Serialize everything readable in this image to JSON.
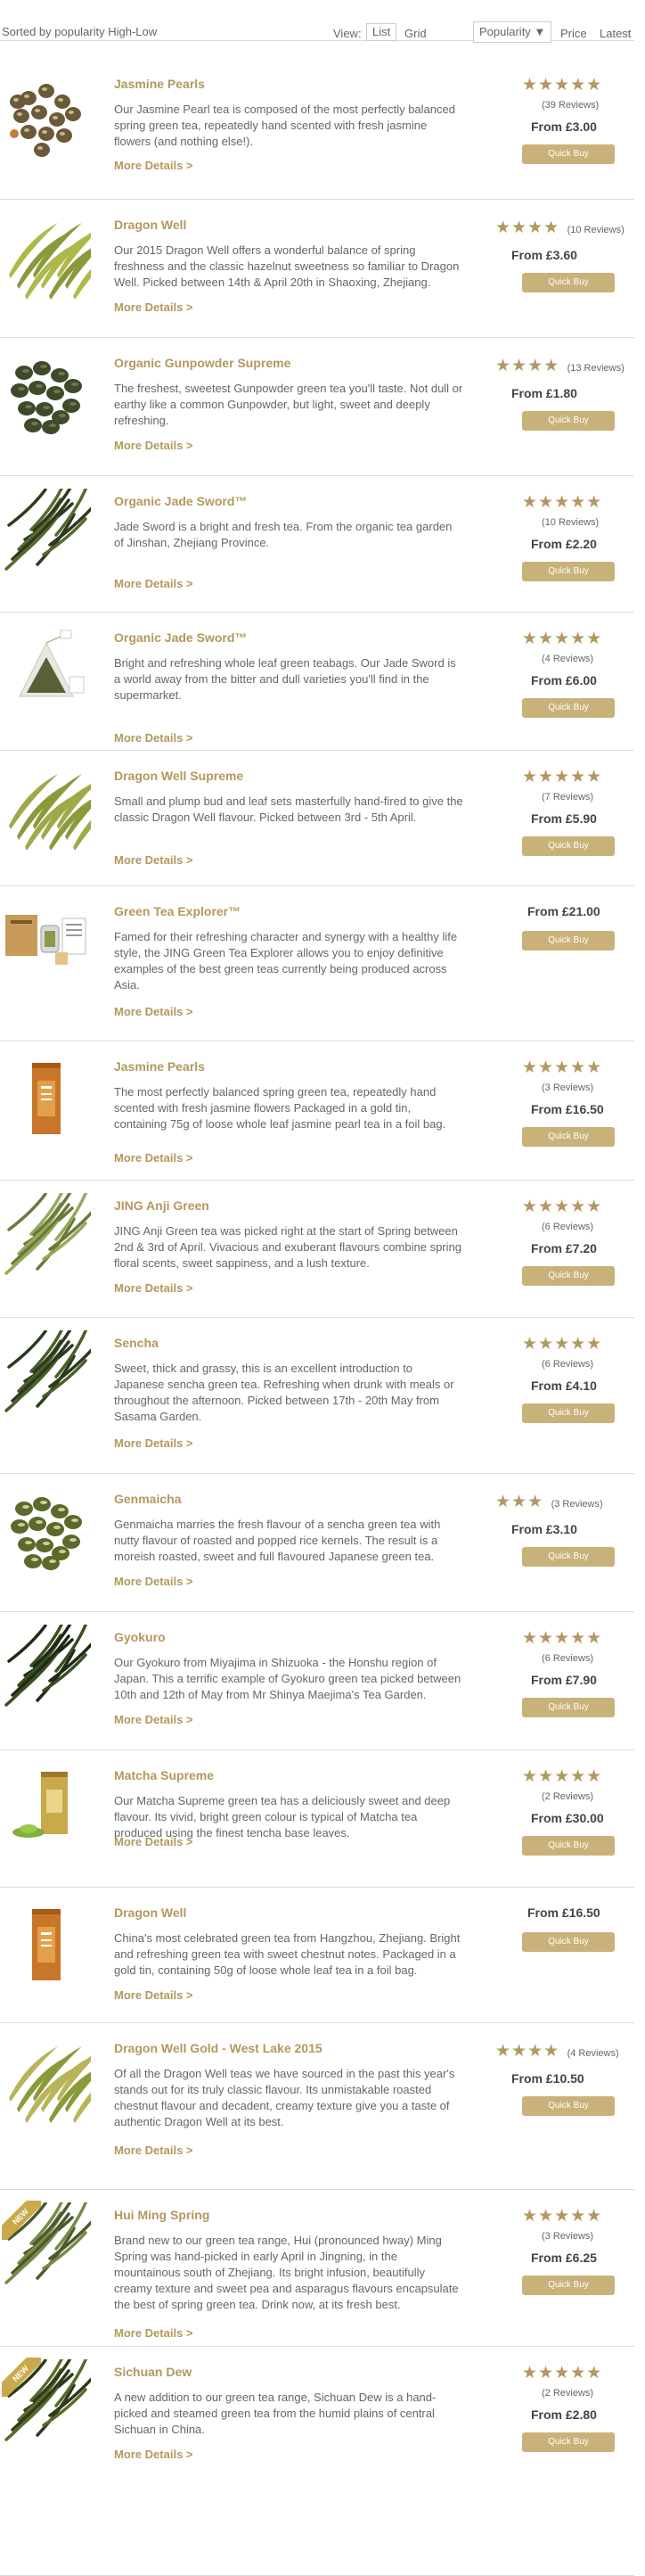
{
  "toolbar": {
    "sorted_by": "Sorted by popularity High-Low",
    "view_label": "View:",
    "view_list": "List",
    "view_grid": "Grid",
    "sort_popularity": "Popularity ▼",
    "sort_price": "Price",
    "sort_latest": "Latest"
  },
  "colors": {
    "accent": "#b3985d",
    "button": "#c9b27a",
    "separator": "#dcdcdc"
  },
  "labels": {
    "more_details": "More Details >",
    "quick_buy": "Quick Buy",
    "new_badge": "NEW"
  },
  "products": [
    {
      "name": "Jasmine Pearls",
      "desc": "Our Jasmine Pearl tea is composed of the most perfectly balanced spring green tea, repeatedly hand scented with fresh jasmine flowers (and nothing else!).",
      "rating": 5,
      "reviews": "(39 Reviews)",
      "price": "From £3.00",
      "image": "jasmine-pearls-image"
    },
    {
      "name": "Dragon Well",
      "desc": "Our 2015 Dragon Well offers a wonderful balance of spring freshness and the classic hazelnut sweetness so familiar to Dragon Well. Picked between 14th & April 20th in Shaoxing, Zhejiang.",
      "rating": 4,
      "reviews": "(10 Reviews)",
      "price": "From £3.60",
      "image": "dragon-well-image"
    },
    {
      "name": "Organic Gunpowder Supreme",
      "desc": "The freshest, sweetest Gunpowder green tea you'll taste. Not dull or earthy like a common Gunpowder, but light, sweet and deeply refreshing.",
      "rating": 4,
      "reviews": "(13 Reviews)",
      "price": "From £1.80",
      "image": "gunpowder-image"
    },
    {
      "name": "Organic Jade Sword™",
      "desc": "Jade Sword is a bright and fresh tea. From the organic tea garden of Jinshan, Zhejiang Province.",
      "rating": 5,
      "reviews": "(10 Reviews)",
      "price": "From £2.20",
      "image": "jade-sword-image"
    },
    {
      "name": "Organic Jade Sword™",
      "desc": "Bright and refreshing whole leaf green teabags. Our Jade Sword is a world away from the bitter and dull varieties you'll find in the supermarket.",
      "rating": 5,
      "reviews": "(4 Reviews)",
      "price": "From £6.00",
      "image": "teabag-image"
    },
    {
      "name": "Dragon Well Supreme",
      "desc": "Small and plump bud and leaf sets masterfully hand-fired to give the classic Dragon Well flavour. Picked between 3rd - 5th April.",
      "rating": 5,
      "reviews": "(7 Reviews)",
      "price": "From £5.90",
      "image": "dragon-well-supreme-image"
    },
    {
      "name": "Green Tea Explorer™",
      "desc": "Famed for their refreshing character and synergy with a healthy life style, the JING Green Tea Explorer allows you to enjoy definitive examples of the best green teas currently being produced across Asia.",
      "rating": 0,
      "reviews": "",
      "price": "From £21.00",
      "image": "explorer-kit-image"
    },
    {
      "name": "Jasmine Pearls",
      "desc": "The most perfectly balanced spring green tea, repeatedly hand scented with fresh jasmine flowers Packaged in a gold tin, containing 75g of loose whole leaf jasmine pearl tea in a foil bag.",
      "rating": 5,
      "reviews": "(3 Reviews)",
      "price": "From £16.50",
      "image": "jasmine-tin-image"
    },
    {
      "name": "JING Anji Green",
      "desc": "JING Anji Green tea was picked right at the start of Spring between 2nd & 3rd of April. Vivacious and exuberant flavours combine spring floral scents, sweet sappiness, and a lush texture.",
      "rating": 5,
      "reviews": "(6 Reviews)",
      "price": "From £7.20",
      "image": "anji-green-image"
    },
    {
      "name": "Sencha",
      "desc": "Sweet, thick and grassy, this is an excellent introduction to Japanese sencha green tea. Refreshing when drunk with meals or throughout the afternoon. Picked between 17th - 20th May from Sasama Garden.",
      "rating": 5,
      "reviews": "(6 Reviews)",
      "price": "From £4.10",
      "image": "sencha-image"
    },
    {
      "name": "Genmaicha",
      "desc": "Genmaicha marries the fresh flavour of a sencha green tea with nutty flavour of roasted and popped rice kernels. The result is a moreish roasted, sweet and full flavoured Japanese green tea.",
      "rating": 3,
      "reviews": "(3 Reviews)",
      "price": "From £3.10",
      "image": "genmaicha-image"
    },
    {
      "name": "Gyokuro",
      "desc": "Our Gyokuro from Miyajima in Shizuoka - the Honshu region of Japan. This a terrific example of Gyokuro green tea picked between 10th and 12th of May from Mr Shinya Maejima's Tea Garden.",
      "rating": 5,
      "reviews": "(6 Reviews)",
      "price": "From £7.90",
      "image": "gyokuro-image"
    },
    {
      "name": "Matcha Supreme",
      "desc": "Our Matcha Supreme green tea has a deliciously sweet and deep flavour. Its vivid, bright green colour is typical of Matcha tea produced using the finest tencha base leaves.",
      "rating": 5,
      "reviews": "(2 Reviews)",
      "price": "From £30.00",
      "image": "matcha-image"
    },
    {
      "name": "Dragon Well",
      "desc": "China's most celebrated green tea from Hangzhou, Zhejiang. Bright and refreshing green tea with sweet chestnut notes. Packaged in a gold tin, containing 50g of loose whole leaf tea in a foil bag.",
      "rating": 0,
      "reviews": "",
      "price": "From £16.50",
      "image": "dragon-well-tin-image"
    },
    {
      "name": "Dragon Well Gold - West Lake 2015",
      "desc": "Of all the Dragon Well teas we have sourced in the past this year's stands out for its truly classic flavour. Its unmistakable roasted chestnut flavour and decadent, creamy texture give you a taste of authentic Dragon Well at its best.",
      "rating": 4,
      "reviews": "(4 Reviews)",
      "price": "From £10.50",
      "image": "dragon-well-gold-image"
    },
    {
      "name": "Hui Ming Spring",
      "desc": "Brand new to our green tea range, Hui (pronounced hway) Ming Spring was hand-picked in early April in Jingning, in the mountainous south of Zhejiang. Its bright infusion, beautifully creamy texture and sweet pea and asparagus flavours encapsulate the best of spring green tea. Drink now, at its fresh best.",
      "rating": 5,
      "reviews": "(3 Reviews)",
      "price": "From £6.25",
      "image": "hui-ming-image",
      "is_new": true
    },
    {
      "name": "Sichuan Dew",
      "desc": "A new addition to our green tea range, Sichuan Dew is a hand-picked and steamed green tea from the humid plains of central Sichuan in China.",
      "rating": 5,
      "reviews": "(2 Reviews)",
      "price": "From £2.80",
      "image": "sichuan-dew-image",
      "is_new": true
    }
  ]
}
